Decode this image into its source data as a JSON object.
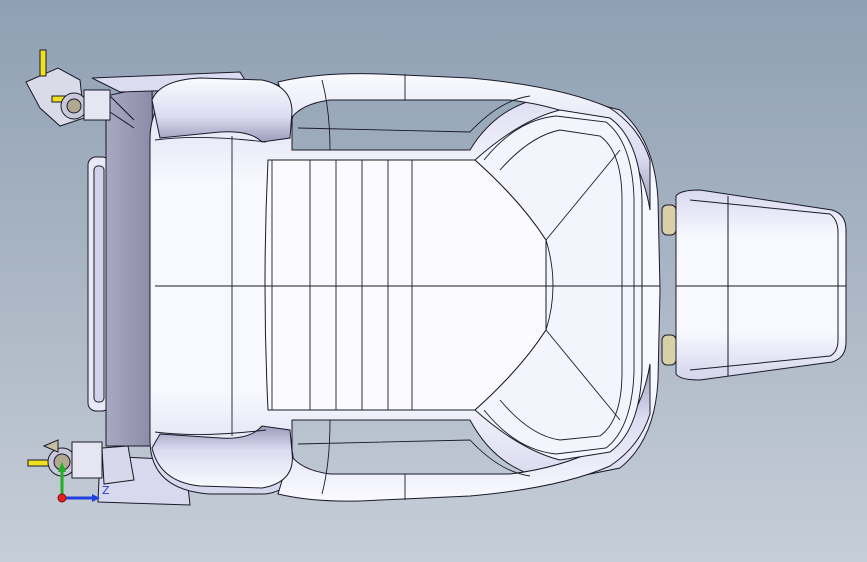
{
  "viewport": {
    "background_top": "#8fa0b4",
    "background_bottom": "#c6ced8",
    "model": "seat-assembly-top-view",
    "line_color": "#1a1a2a",
    "surface_color": "#f2f2fb",
    "shade_color": "#8e8ea8"
  },
  "triad": {
    "axes": [
      {
        "name": "X",
        "color": "#e02020"
      },
      {
        "name": "Y",
        "color": "#20b020"
      },
      {
        "name": "Z",
        "color": "#2040e0",
        "label": "Z"
      }
    ]
  },
  "icons": [
    "orientation-triad-icon"
  ]
}
